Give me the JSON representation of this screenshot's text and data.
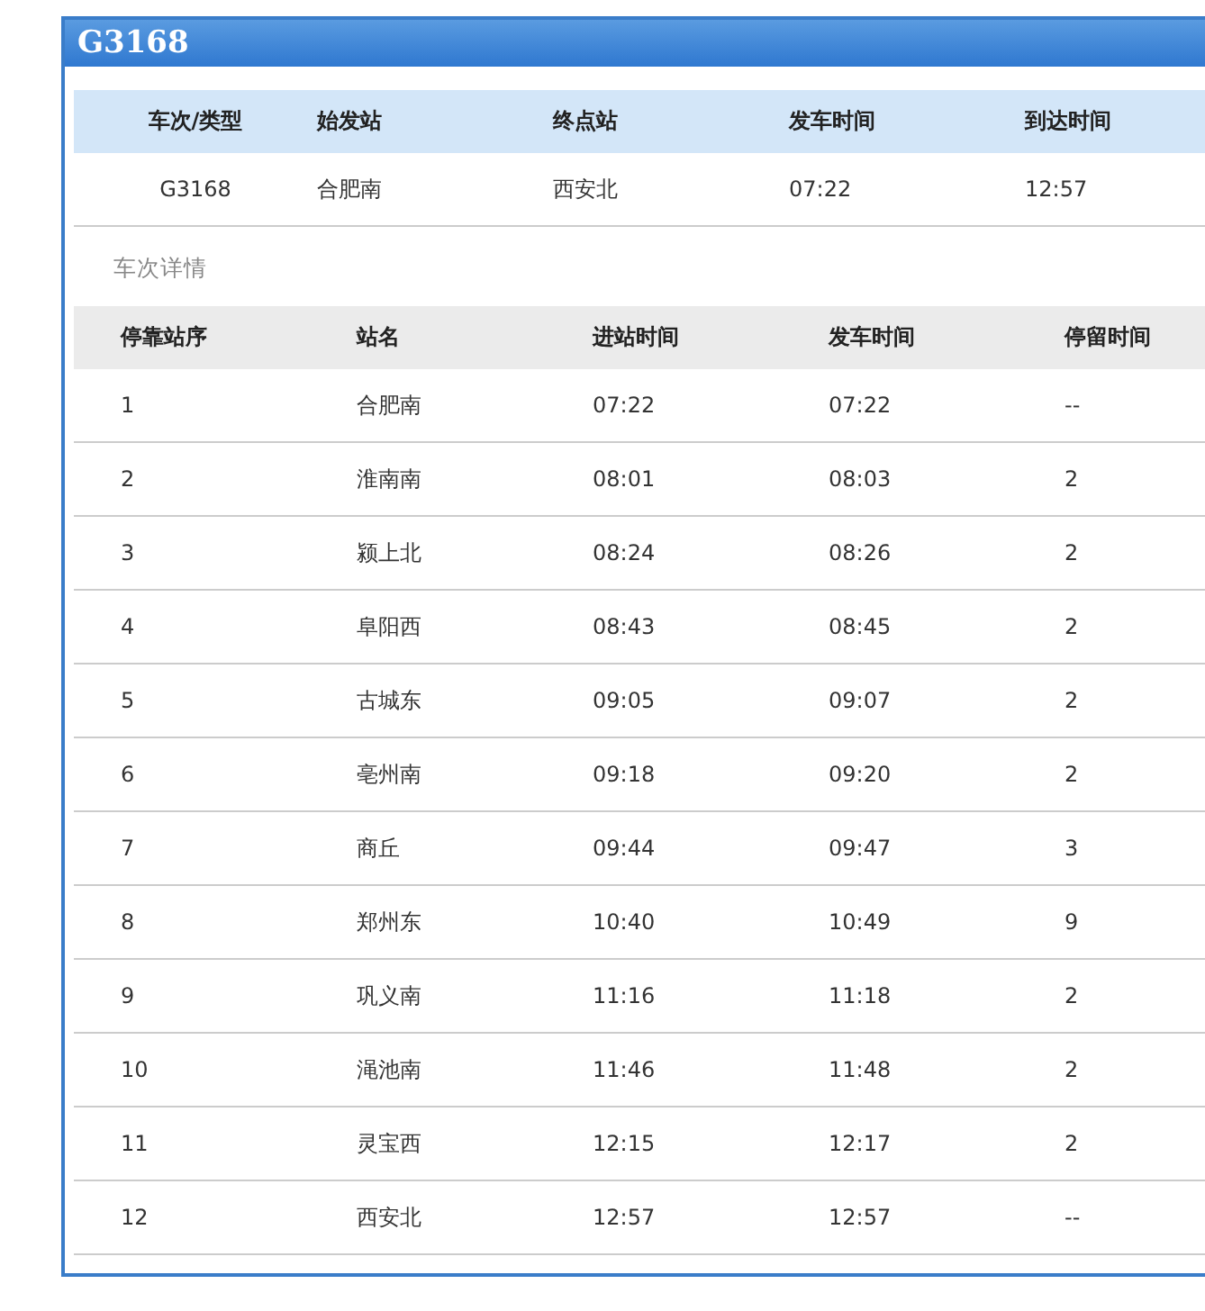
{
  "panel": {
    "title": "G3168"
  },
  "summary": {
    "columns": [
      "车次/类型",
      "始发站",
      "终点站",
      "发车时间",
      "到达时间"
    ],
    "row": [
      "G3168",
      "合肥南",
      "西安北",
      "07:22",
      "12:57"
    ]
  },
  "details": {
    "label": "车次详情",
    "columns": [
      "停靠站序",
      "站名",
      "进站时间",
      "发车时间",
      "停留时间"
    ],
    "rows": [
      [
        "1",
        "合肥南",
        "07:22",
        "07:22",
        "--"
      ],
      [
        "2",
        "淮南南",
        "08:01",
        "08:03",
        "2"
      ],
      [
        "3",
        "颍上北",
        "08:24",
        "08:26",
        "2"
      ],
      [
        "4",
        "阜阳西",
        "08:43",
        "08:45",
        "2"
      ],
      [
        "5",
        "古城东",
        "09:05",
        "09:07",
        "2"
      ],
      [
        "6",
        "亳州南",
        "09:18",
        "09:20",
        "2"
      ],
      [
        "7",
        "商丘",
        "09:44",
        "09:47",
        "3"
      ],
      [
        "8",
        "郑州东",
        "10:40",
        "10:49",
        "9"
      ],
      [
        "9",
        "巩义南",
        "11:16",
        "11:18",
        "2"
      ],
      [
        "10",
        "渑池南",
        "11:46",
        "11:48",
        "2"
      ],
      [
        "11",
        "灵宝西",
        "12:15",
        "12:17",
        "2"
      ],
      [
        "12",
        "西安北",
        "12:57",
        "12:57",
        "--"
      ]
    ]
  }
}
